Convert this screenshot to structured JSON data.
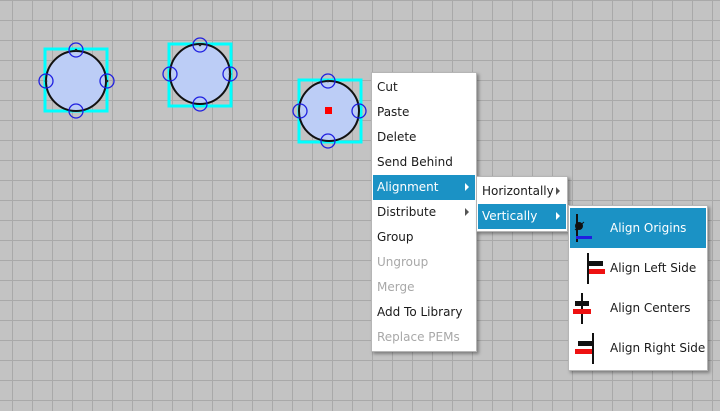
{
  "colors": {
    "selection": "#00ffff",
    "shape_fill": "#bccdf6",
    "handle": "#1f1fe0",
    "highlight": "#1b92c5",
    "origin_marker": "#ff0000"
  },
  "context_menu": {
    "items": [
      {
        "label": "Cut"
      },
      {
        "label": "Paste"
      },
      {
        "label": "Delete"
      },
      {
        "label": "Send Behind"
      },
      {
        "label": "Alignment"
      },
      {
        "label": "Distribute"
      },
      {
        "label": "Group"
      },
      {
        "label": "Ungroup"
      },
      {
        "label": "Merge"
      },
      {
        "label": "Add To Library"
      },
      {
        "label": "Replace PEMs"
      }
    ]
  },
  "alignment_submenu": {
    "items": [
      {
        "label": "Horizontally"
      },
      {
        "label": "Vertically"
      }
    ]
  },
  "vertical_submenu": {
    "items": [
      {
        "label": "Align Origins",
        "icon": "align-origins-icon"
      },
      {
        "label": "Align Left Side",
        "icon": "align-left-side-icon"
      },
      {
        "label": "Align Centers",
        "icon": "align-centers-icon"
      },
      {
        "label": "Align Right Side",
        "icon": "align-right-side-icon"
      }
    ]
  }
}
